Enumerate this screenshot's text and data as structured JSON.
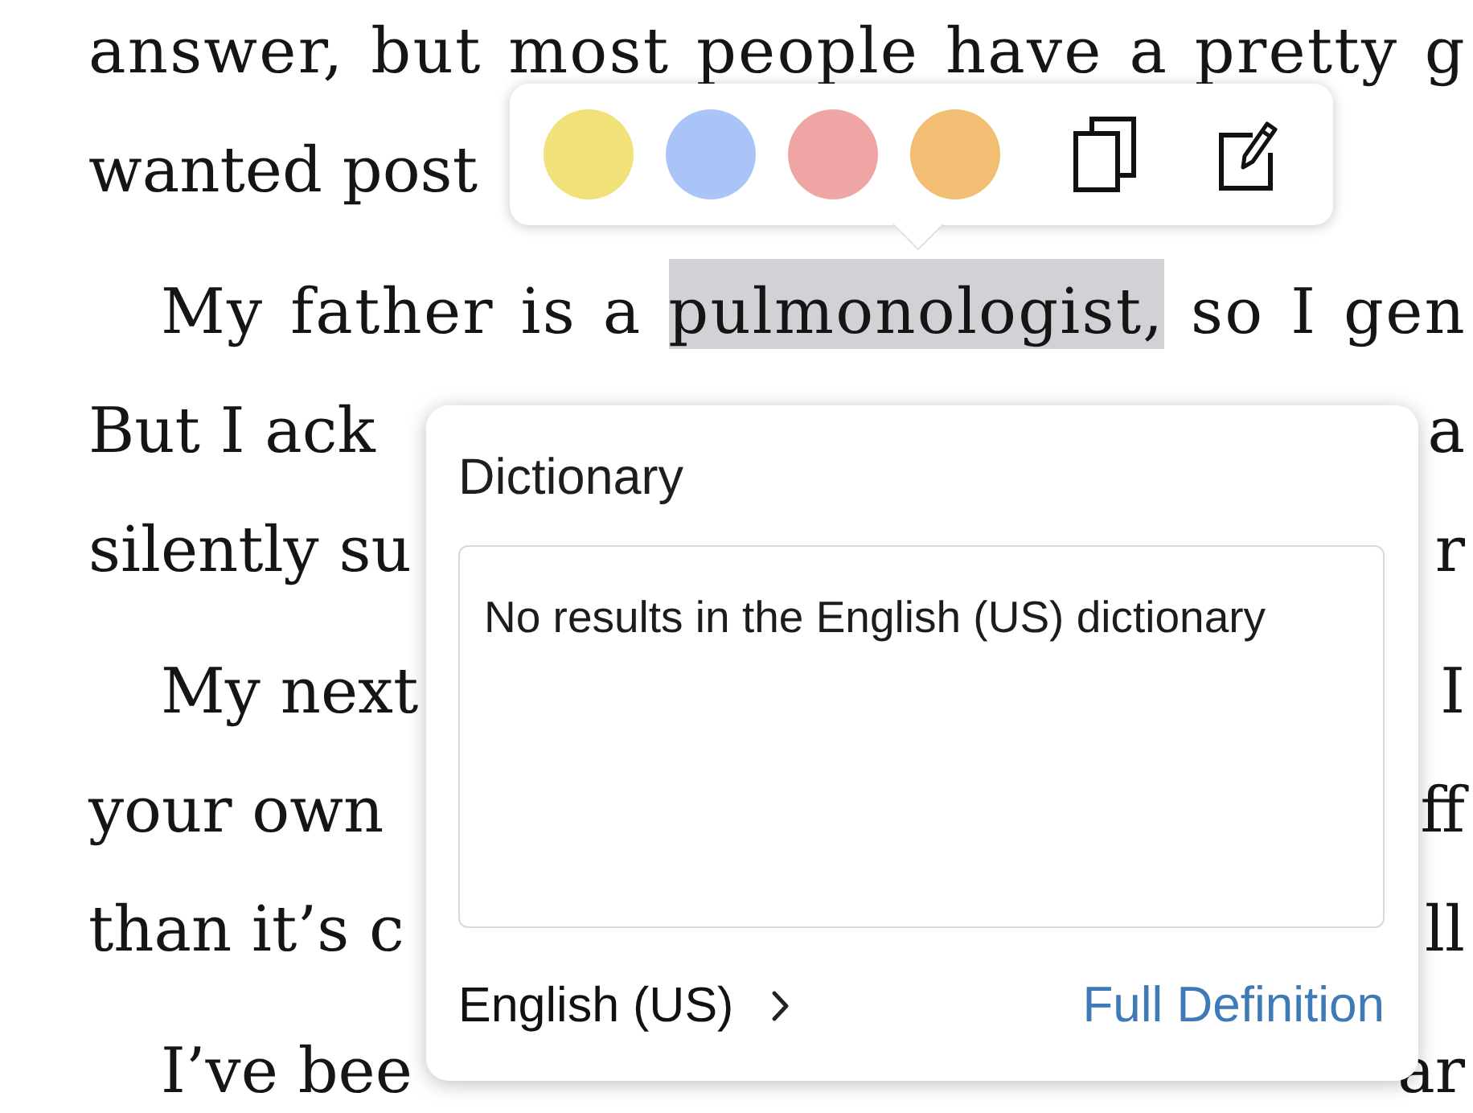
{
  "book_text": {
    "paragraphs": [
      {
        "indented": false,
        "lines": [
          {
            "segments": [
              {
                "text": "answer, but most people have a pretty g",
                "selected": false
              }
            ]
          },
          {
            "segments": [
              {
                "text": "wanted post",
                "selected": false
              }
            ]
          }
        ]
      },
      {
        "indented": true,
        "lines": [
          {
            "segments": [
              {
                "text": "My father is a ",
                "selected": false
              },
              {
                "text": "pulmonologist,",
                "selected": true
              },
              {
                "text": " so I gen",
                "selected": false
              }
            ]
          },
          {
            "segments": [
              {
                "text": "But I ack",
                "selected": false
              }
            ],
            "right": "a"
          },
          {
            "segments": [
              {
                "text": "silently su",
                "selected": false
              }
            ],
            "right": "r"
          }
        ]
      },
      {
        "indented": true,
        "lines": [
          {
            "segments": [
              {
                "text": "My next",
                "selected": false
              }
            ],
            "right": "I"
          },
          {
            "segments": [
              {
                "text": "your own",
                "selected": false
              }
            ],
            "right": "ff"
          },
          {
            "segments": [
              {
                "text": "than it’s c",
                "selected": false
              }
            ],
            "right": "ll"
          }
        ]
      },
      {
        "indented": true,
        "lines": [
          {
            "segments": [
              {
                "text": "I’ve bee",
                "selected": false
              }
            ],
            "right": "ar"
          }
        ]
      }
    ]
  },
  "highlight_toolbar": {
    "swatches": [
      {
        "color": "#f0e278"
      },
      {
        "color": "#abc4f7"
      },
      {
        "color": "#f0a5a5"
      },
      {
        "color": "#f2be74"
      }
    ],
    "actions": [
      {
        "kind": "copy"
      },
      {
        "kind": "note"
      }
    ]
  },
  "dictionary_popup": {
    "title": "Dictionary",
    "message": "No results in the English (US) dictionary",
    "language": "English (US)",
    "full_definition_link": "Full Definition"
  }
}
